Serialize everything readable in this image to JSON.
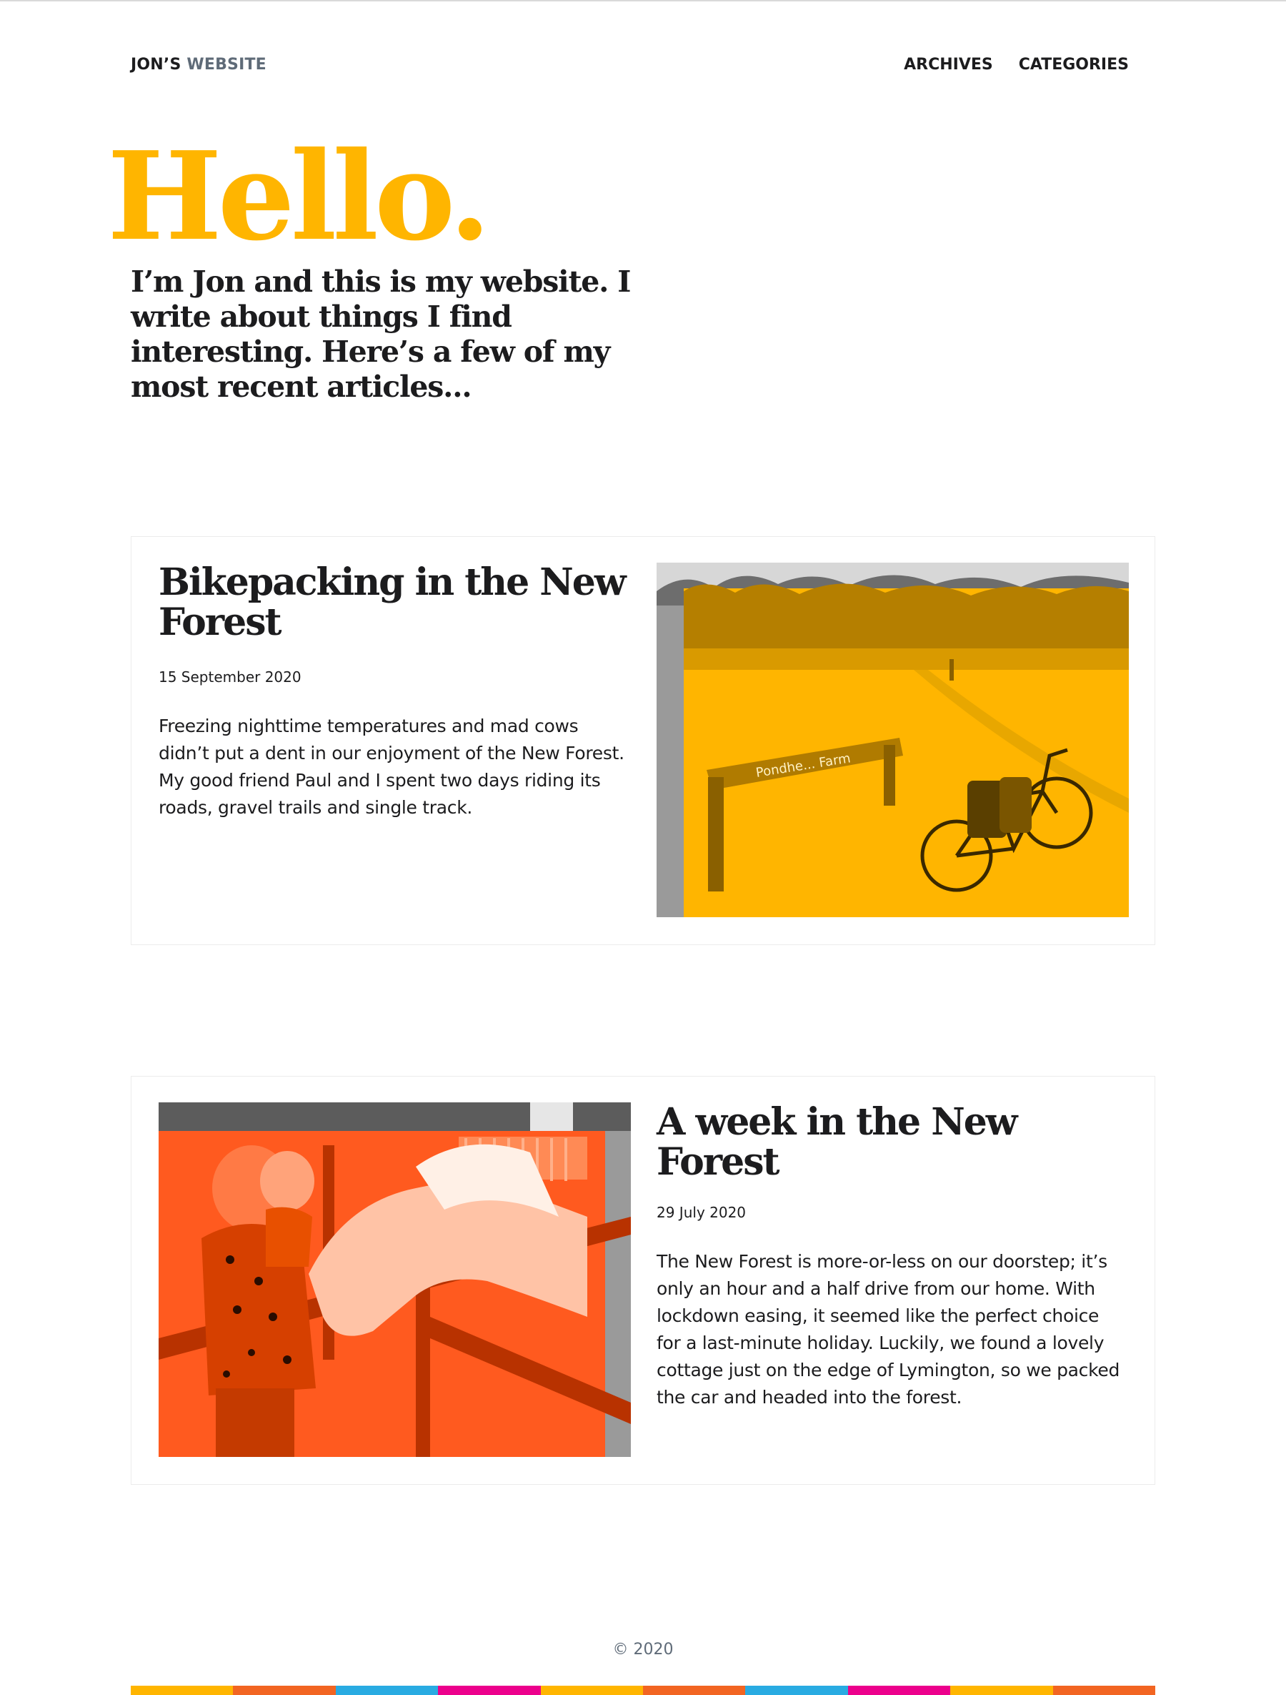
{
  "header": {
    "logo_main": "JON’S",
    "logo_accent": "WEBSITE",
    "nav": [
      "ARCHIVES",
      "CATEGORIES"
    ]
  },
  "hero": {
    "title": "Hello.",
    "intro": "I’m Jon and this is my website. I write about things I find interesting. Here’s a few of my most recent articles..."
  },
  "articles": [
    {
      "title": "Bikepacking in the New Forest",
      "date": "15 September 2020",
      "excerpt": "Freezing nighttime temperatures and mad cows didn’t put a dent in our enjoyment of the New Forest. My good friend Paul and I spent two days riding its roads, gravel trails and single track.",
      "image_tint": "#ffb500",
      "sign_text": "Pondhe... Farm"
    },
    {
      "title": "A week in the New Forest",
      "date": "29 July 2020",
      "excerpt": "The New Forest is more-or-less on our doorstep; it’s only an hour and a half drive from our home. With lockdown easing, it seemed like the perfect choice for a last-minute holiday. Luckily, we found a lovely cottage just on the edge of Lymington, so we packed the car and headed into the forest.",
      "image_tint": "#ff5a1f"
    }
  ],
  "footer": {
    "copyright": "© 2020",
    "stripe_colors": [
      "#ffb500",
      "#f26522",
      "#29abe2",
      "#ec008c",
      "#ffb500",
      "#f26522",
      "#29abe2",
      "#ec008c",
      "#ffb500",
      "#f26522"
    ]
  }
}
